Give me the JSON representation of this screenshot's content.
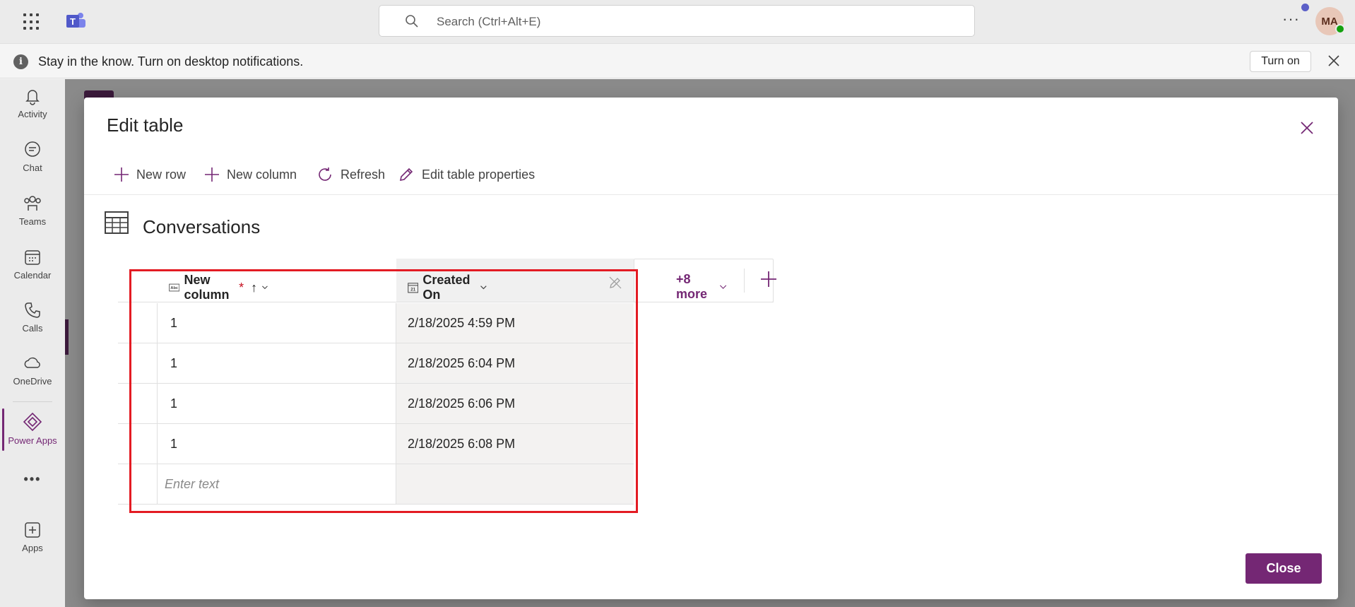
{
  "topbar": {
    "search_placeholder": "Search (Ctrl+Alt+E)",
    "more": "···",
    "avatar_initials": "MA"
  },
  "infobar": {
    "message": "Stay in the know. Turn on desktop notifications.",
    "turn_on_label": "Turn on"
  },
  "rail": {
    "items": [
      {
        "label": "Activity",
        "icon": "bell-icon"
      },
      {
        "label": "Chat",
        "icon": "chat-icon"
      },
      {
        "label": "Teams",
        "icon": "teams-icon"
      },
      {
        "label": "Calendar",
        "icon": "calendar-icon"
      },
      {
        "label": "Calls",
        "icon": "phone-icon"
      },
      {
        "label": "OneDrive",
        "icon": "cloud-icon"
      },
      {
        "label": "Power Apps",
        "icon": "power-apps-icon"
      },
      {
        "label": "Apps",
        "icon": "apps-plus-icon"
      }
    ],
    "more_dots": "•••"
  },
  "dialog": {
    "title": "Edit table",
    "toolbar": {
      "new_row": "New row",
      "new_column": "New column",
      "refresh": "Refresh",
      "edit_props": "Edit table properties"
    },
    "table_name": "Conversations",
    "columns": {
      "col1": "New column",
      "col1_required": "*",
      "col1_sort": "↑",
      "col2": "Created On",
      "more": "+8 more"
    },
    "rows": [
      {
        "c1": "1",
        "c2": "2/18/2025 4:59 PM"
      },
      {
        "c1": "1",
        "c2": "2/18/2025 6:04 PM"
      },
      {
        "c1": "1",
        "c2": "2/18/2025 6:06 PM"
      },
      {
        "c1": "1",
        "c2": "2/18/2025 6:08 PM"
      }
    ],
    "new_row_placeholder": "Enter text",
    "close_label": "Close"
  },
  "colors": {
    "accent": "#742774",
    "highlight": "#e31b23"
  }
}
